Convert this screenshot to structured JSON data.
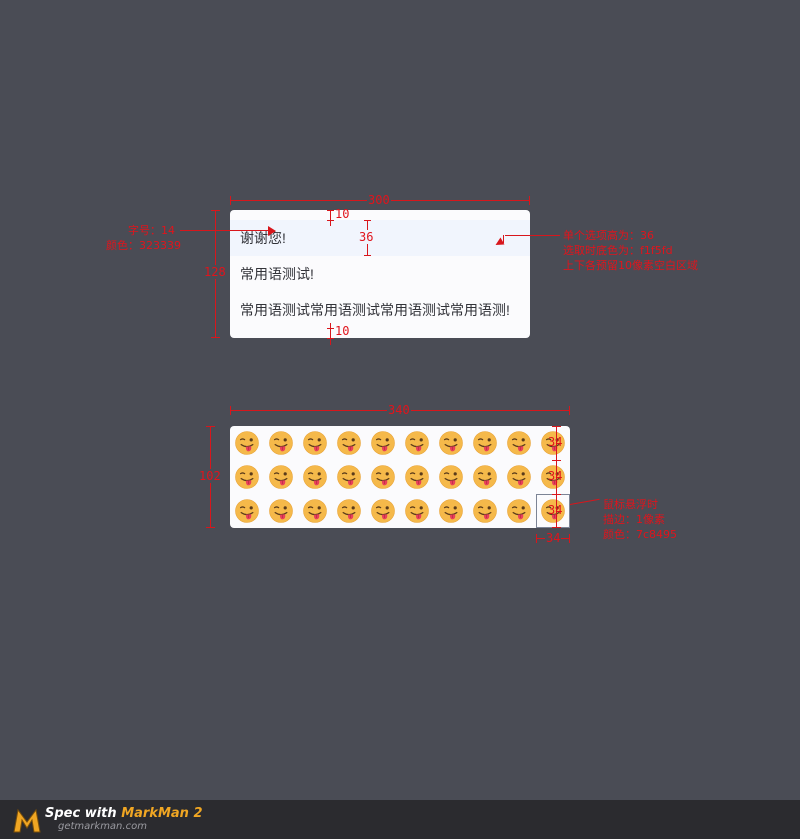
{
  "phrases": {
    "options": [
      "谢谢您!",
      "常用语测试!",
      "常用语测试常用语测试常用语测试常用语测!"
    ],
    "selected_index": 0,
    "font_color": "#323339",
    "selected_bg": "#f1f5fd"
  },
  "spec": {
    "panel_width": "300",
    "panel_height": "128",
    "pad_top": "10",
    "option_height": "36",
    "pad_bottom": "10",
    "font_note": {
      "line1": "字号：14",
      "line2": "颜色：323339"
    },
    "option_note": {
      "line1": "单个选项高为：36",
      "line2": "选取时底色为：f1f5fd",
      "line3": "上下各预留10像素空白区域"
    },
    "emoji_width": "340",
    "emoji_height": "102",
    "cell_size": "34",
    "hover_note": {
      "line1": "鼠标悬浮时",
      "line2": "描边：1像素",
      "line3": "颜色：7c8495"
    }
  },
  "emoji": {
    "rows": 3,
    "cols": 10,
    "icon": "winking-tongue-face-icon",
    "hover_cell": {
      "row": 2,
      "col": 9
    },
    "hover_border": "#7c8495"
  },
  "footer": {
    "brand_prefix": "Spec with ",
    "brand_name": "MarkMan 2",
    "url": "getmarkman.com"
  }
}
